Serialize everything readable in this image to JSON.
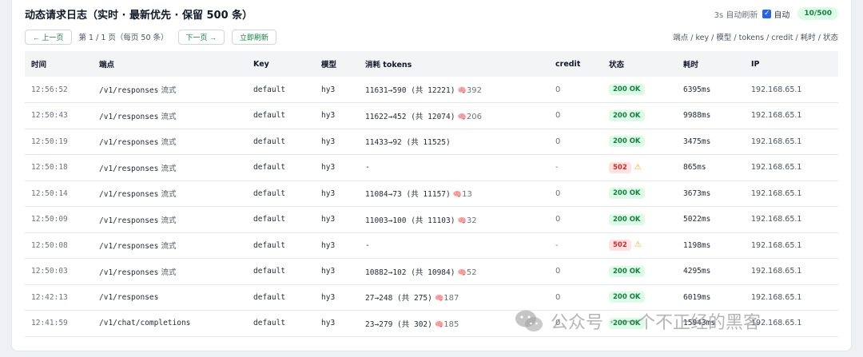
{
  "header": {
    "title": "动态请求日志（实时 · 最新优先 · 保留 500 条）",
    "refresh_text": "3s 自动刷新",
    "auto_label": "自动",
    "counter": "10/500"
  },
  "toolbar": {
    "prev_label": "← 上一页",
    "page_info": "第 1 / 1 页（每页 50 条）",
    "next_label": "下一页 →",
    "refresh_label": "立即刷新",
    "hint": "端点 / key / 模型 / tokens / credit / 耗时 / 状态"
  },
  "table": {
    "columns": [
      "时间",
      "端点",
      "Key",
      "模型",
      "消耗 tokens",
      "credit",
      "状态",
      "耗时",
      "IP"
    ],
    "rows": [
      {
        "time": "12:56:52",
        "endpoint": "/v1/responses",
        "stream": "流式",
        "key": "default",
        "model": "hy3",
        "tokens": "11631→590 (共 12221)",
        "reasoning": "392",
        "credit": "0",
        "status": "200 OK",
        "status_type": "ok",
        "duration": "6395ms",
        "ip": "192.168.65.1"
      },
      {
        "time": "12:50:43",
        "endpoint": "/v1/responses",
        "stream": "流式",
        "key": "default",
        "model": "hy3",
        "tokens": "11622→452 (共 12074)",
        "reasoning": "206",
        "credit": "0",
        "status": "200 OK",
        "status_type": "ok",
        "duration": "9988ms",
        "ip": "192.168.65.1"
      },
      {
        "time": "12:50:19",
        "endpoint": "/v1/responses",
        "stream": "流式",
        "key": "default",
        "model": "hy3",
        "tokens": "11433→92 (共 11525)",
        "reasoning": "",
        "credit": "0",
        "status": "200 OK",
        "status_type": "ok",
        "duration": "3475ms",
        "ip": "192.168.65.1"
      },
      {
        "time": "12:50:18",
        "endpoint": "/v1/responses",
        "stream": "流式",
        "key": "default",
        "model": "hy3",
        "tokens": "-",
        "reasoning": "",
        "credit": "-",
        "status": "502",
        "status_type": "err",
        "duration": "865ms",
        "ip": "192.168.65.1"
      },
      {
        "time": "12:50:14",
        "endpoint": "/v1/responses",
        "stream": "流式",
        "key": "default",
        "model": "hy3",
        "tokens": "11084→73 (共 11157)",
        "reasoning": "13",
        "credit": "0",
        "status": "200 OK",
        "status_type": "ok",
        "duration": "3673ms",
        "ip": "192.168.65.1"
      },
      {
        "time": "12:50:09",
        "endpoint": "/v1/responses",
        "stream": "流式",
        "key": "default",
        "model": "hy3",
        "tokens": "11003→100 (共 11103)",
        "reasoning": "32",
        "credit": "0",
        "status": "200 OK",
        "status_type": "ok",
        "duration": "5022ms",
        "ip": "192.168.65.1"
      },
      {
        "time": "12:50:08",
        "endpoint": "/v1/responses",
        "stream": "流式",
        "key": "default",
        "model": "hy3",
        "tokens": "-",
        "reasoning": "",
        "credit": "-",
        "status": "502",
        "status_type": "err",
        "duration": "1198ms",
        "ip": "192.168.65.1"
      },
      {
        "time": "12:50:03",
        "endpoint": "/v1/responses",
        "stream": "流式",
        "key": "default",
        "model": "hy3",
        "tokens": "10882→102 (共 10984)",
        "reasoning": "52",
        "credit": "0",
        "status": "200 OK",
        "status_type": "ok",
        "duration": "4295ms",
        "ip": "192.168.65.1"
      },
      {
        "time": "12:42:13",
        "endpoint": "/v1/responses",
        "stream": "",
        "key": "default",
        "model": "hy3",
        "tokens": "27→248 (共 275)",
        "reasoning": "187",
        "credit": "0",
        "status": "200 OK",
        "status_type": "ok",
        "duration": "6019ms",
        "ip": "192.168.65.1"
      },
      {
        "time": "12:41:59",
        "endpoint": "/v1/chat/completions",
        "stream": "",
        "key": "default",
        "model": "hy3",
        "tokens": "23→279 (共 302)",
        "reasoning": "185",
        "credit": "0",
        "status": "200 OK",
        "status_type": "ok",
        "duration": "15943ms",
        "ip": "192.168.65.1"
      }
    ]
  },
  "watermark": {
    "text": "公众号 · 一个不正经的黑客"
  },
  "colors": {
    "accent": "#15803d",
    "ok_bg": "#dcfce7",
    "err_bg": "#fee2e2",
    "err_fg": "#dc2626",
    "reasoning": "#d946ef",
    "checkbox": "#2563eb"
  }
}
